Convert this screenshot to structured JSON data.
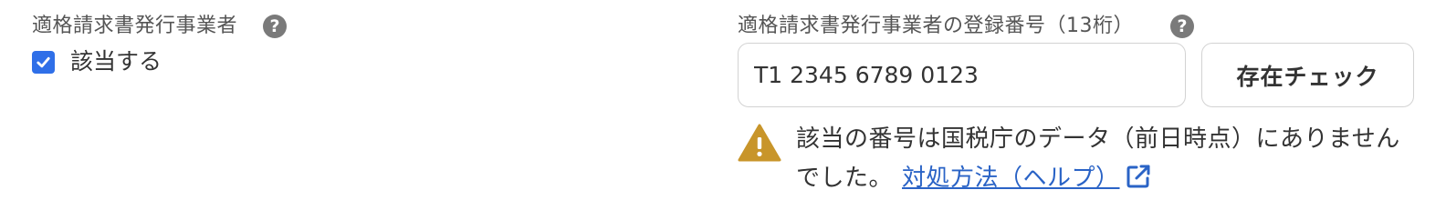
{
  "qualified_issuer": {
    "label": "適格請求書発行事業者",
    "help_icon": "?",
    "checkbox": {
      "checked": true,
      "label": "該当する"
    }
  },
  "registration_number": {
    "label": "適格請求書発行事業者の登録番号（13桁）",
    "help_icon": "?",
    "value": "T1 2345 6789 0123",
    "check_button_label": "存在チェック"
  },
  "warning": {
    "icon": "warning-triangle-icon",
    "message": "該当の番号は国税庁のデータ（前日時点）にありませんでした。",
    "help_link_label": "対処方法（ヘルプ）",
    "link_icon": "external-link-icon"
  },
  "colors": {
    "accent": "#2f6fe8",
    "link": "#2a63c6",
    "warning": "#c8952a",
    "help_icon": "#7a7a7a"
  }
}
